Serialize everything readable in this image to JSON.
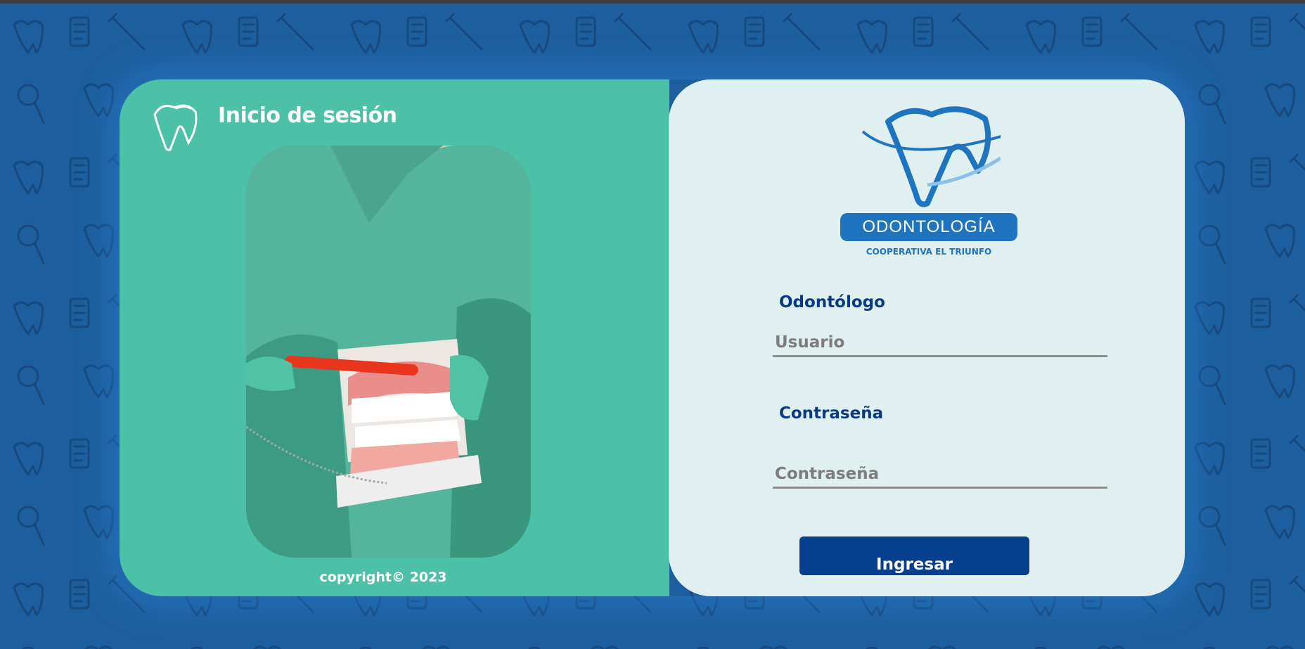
{
  "left_panel": {
    "title": "Inicio de sesión",
    "copyright": "copyright© 2023",
    "logo_icon": "tooth-outline-icon",
    "photo": "dentist-holding-dental-model"
  },
  "brand": {
    "name": "ODONTOLOGÍA",
    "subtitle": "COOPERATIVA EL TRIUNFO",
    "icon": "tooth-logo-icon"
  },
  "form": {
    "user_label": "Odontólogo",
    "user_placeholder": "Usuario",
    "password_label": "Contraseña",
    "password_placeholder": "Contraseña",
    "submit_label": "Ingresar"
  },
  "colors": {
    "background": "#1d5f9e",
    "left_panel": "#4cc1a7",
    "right_panel": "#e0eff0",
    "primary_dark": "#053f8e",
    "brand_blue": "#1f74bf"
  }
}
